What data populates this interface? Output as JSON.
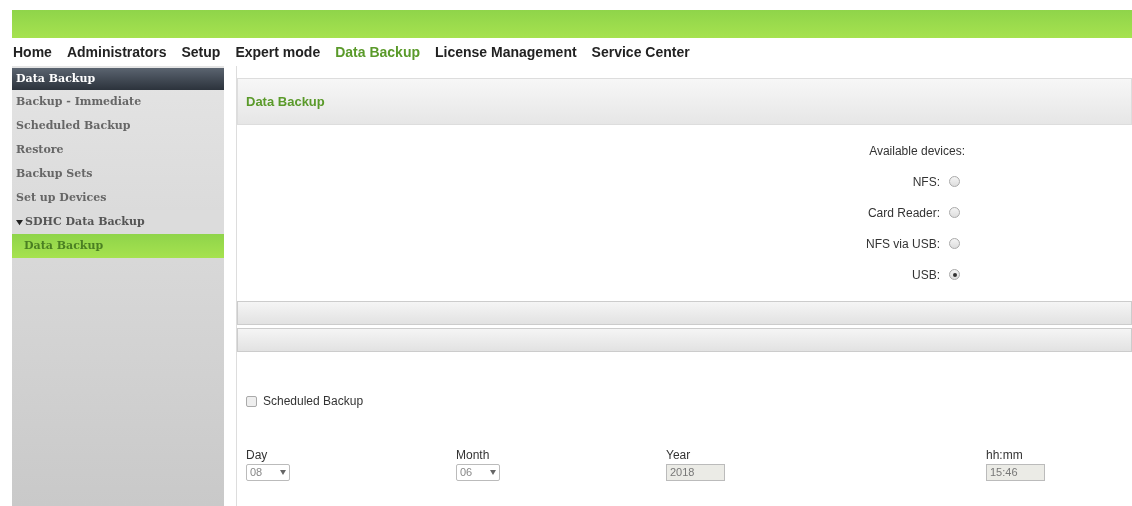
{
  "nav": [
    {
      "label": "Home",
      "selected": false
    },
    {
      "label": "Administrators",
      "selected": false
    },
    {
      "label": "Setup",
      "selected": false
    },
    {
      "label": "Expert mode",
      "selected": false
    },
    {
      "label": "Data Backup",
      "selected": true
    },
    {
      "label": "License Management",
      "selected": false
    },
    {
      "label": "Service Center",
      "selected": false
    }
  ],
  "sidebar": {
    "title": "Data Backup",
    "items": [
      {
        "label": "Backup - Immediate",
        "selected": false
      },
      {
        "label": "Scheduled Backup",
        "selected": false
      },
      {
        "label": "Restore",
        "selected": false
      },
      {
        "label": "Backup Sets",
        "selected": false
      },
      {
        "label": "Set up Devices",
        "selected": false
      },
      {
        "label": "SDHC Data Backup",
        "selected": false,
        "expanded": true,
        "children": [
          {
            "label": "Data Backup",
            "selected": true
          }
        ]
      }
    ]
  },
  "panel": {
    "title": "Data Backup",
    "devices_label": "Available devices:",
    "devices": [
      {
        "label": "NFS:",
        "selected": false
      },
      {
        "label": "Card Reader:",
        "selected": false
      },
      {
        "label": "NFS via USB:",
        "selected": false
      },
      {
        "label": "USB:",
        "selected": true
      }
    ],
    "scheduled": {
      "label": "Scheduled Backup",
      "checked": false
    },
    "fields": [
      {
        "kind": "select",
        "label": "Day",
        "value": "08"
      },
      {
        "kind": "select",
        "label": "Month",
        "value": "06"
      },
      {
        "kind": "text",
        "label": "Year",
        "value": "2018"
      },
      {
        "kind": "text",
        "label": "hh:mm",
        "value": "15:46"
      }
    ]
  }
}
